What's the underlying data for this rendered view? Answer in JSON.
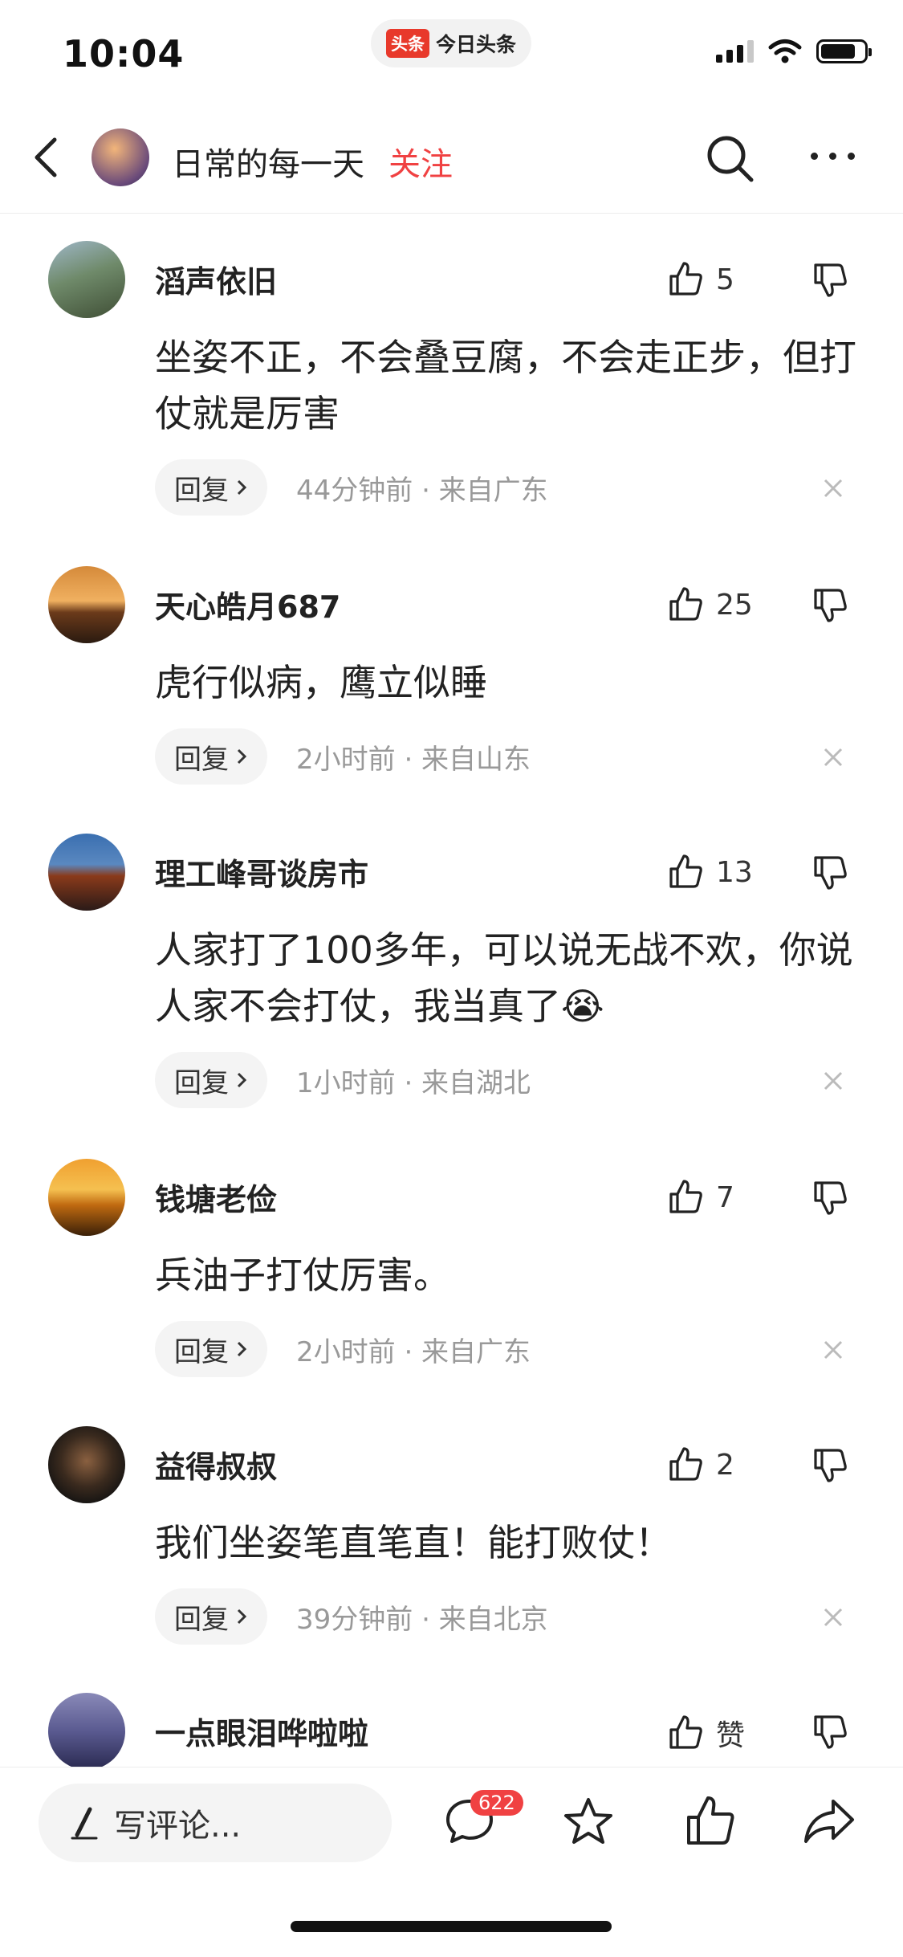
{
  "status_bar": {
    "time": "10:04",
    "app_logo": "头条",
    "app_name": "今日头条"
  },
  "header": {
    "account_name": "日常的每一天",
    "follow_label": "关注"
  },
  "comments": [
    {
      "username": "滔声依旧",
      "likes": "5",
      "text": "坐姿不正，不会叠豆腐，不会走正步，但打仗就是厉害",
      "reply_label": "回复",
      "meta": "44分钟前 · 来自广东"
    },
    {
      "username": "天心皓月687",
      "likes": "25",
      "text": "虎行似病，鹰立似睡",
      "reply_label": "回复",
      "meta": "2小时前 · 来自山东"
    },
    {
      "username": "理工峰哥谈房市",
      "likes": "13",
      "text": "人家打了100多年，可以说无战不欢，你说人家不会打仗，我当真了😭",
      "reply_label": "回复",
      "meta": "1小时前 · 来自湖北"
    },
    {
      "username": "钱塘老俭",
      "likes": "7",
      "text": "兵油子打仗厉害。",
      "reply_label": "回复",
      "meta": "2小时前 · 来自广东"
    },
    {
      "username": "益得叔叔",
      "likes": "2",
      "text": "我们坐姿笔直笔直！能打败仗！",
      "reply_label": "回复",
      "meta": "39分钟前 · 来自北京"
    },
    {
      "username": "一点眼泪哗啦啦",
      "likes": "赞"
    }
  ],
  "bottom_bar": {
    "write_placeholder": "写评论...",
    "comment_count": "622"
  },
  "colors": {
    "accent": "#f04142",
    "reply_bg": "#f4f4f4",
    "meta": "#999999"
  }
}
